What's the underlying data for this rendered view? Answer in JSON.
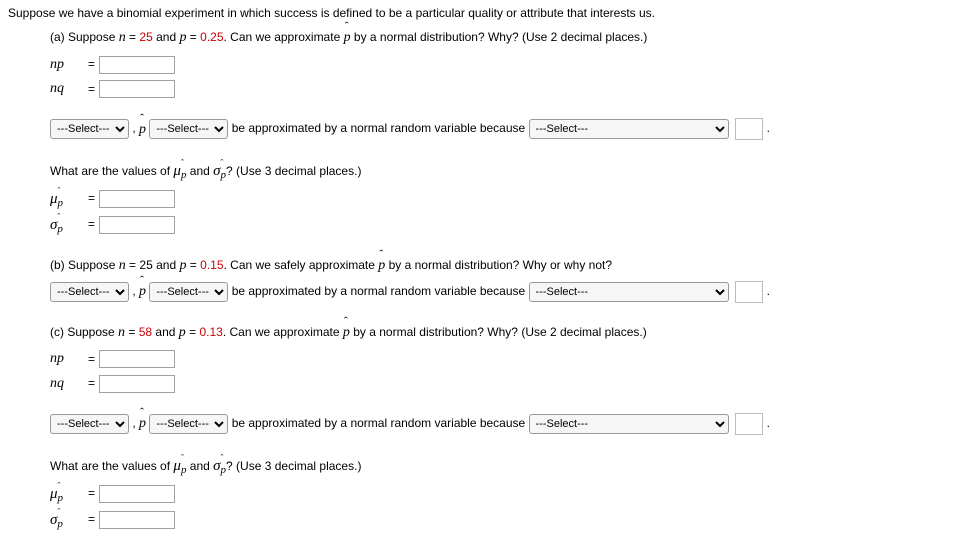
{
  "intro": "Suppose we have a binomial experiment in which success is defined to be a particular quality or attribute that interests us.",
  "a": {
    "q": {
      "prefix": "(a) Suppose ",
      "nlabel": "n",
      "eq1": " = ",
      "nval": "25",
      "and": " and ",
      "plabel": "p",
      "eq2": " = ",
      "pval": "0.25",
      "rest": ". Can we approximate ",
      "tail": " by a normal distribution? Why? (Use 2 decimal places.)"
    },
    "np_label": "np",
    "nq_label": "nq",
    "sentence": {
      "comma": " , ",
      "mid": " be approximated by a normal random variable because ",
      "period": "."
    },
    "select_placeholder": "---Select---",
    "values_q": {
      "prefix": "What are the values of ",
      "and": " and ",
      "tail": "? (Use 3 decimal places.)"
    },
    "mu_label_html": "μ",
    "sigma_label_html": "σ"
  },
  "b": {
    "q": {
      "prefix": "(b) Suppose ",
      "nlabel": "n",
      "eq1": " = ",
      "nval": "25",
      "and": " and ",
      "plabel": "p",
      "eq2": " = ",
      "pval": "0.15",
      "rest": ". Can we safely approximate ",
      "tail": " by a normal distribution? Why or why not?"
    },
    "sentence": {
      "comma": " , ",
      "mid": " be approximated by a normal random variable because ",
      "period": "."
    },
    "select_placeholder": "---Select---"
  },
  "c": {
    "q": {
      "prefix": "(c) Suppose ",
      "nlabel": "n",
      "eq1": " = ",
      "nval": "58",
      "and": " and ",
      "plabel": "p",
      "eq2": " = ",
      "pval": "0.13",
      "rest": ". Can we approximate ",
      "tail": " by a normal distribution? Why? (Use 2 decimal places.)"
    },
    "np_label": "np",
    "nq_label": "nq",
    "sentence": {
      "comma": " , ",
      "mid": " be approximated by a normal random variable because ",
      "period": "."
    },
    "select_placeholder": "---Select---",
    "values_q": {
      "prefix": "What are the values of ",
      "and": " and ",
      "tail": "? (Use 3 decimal places.)"
    }
  },
  "eq_sign": " = "
}
